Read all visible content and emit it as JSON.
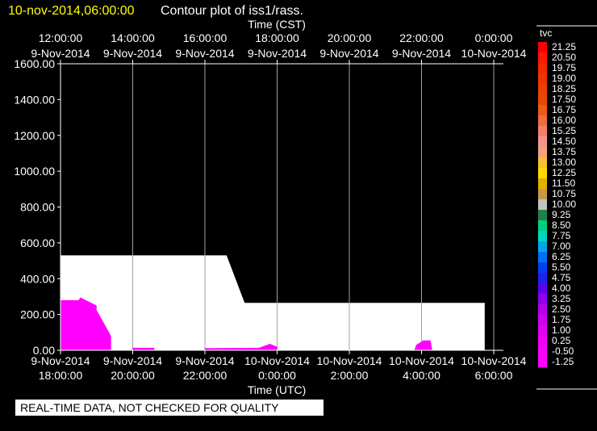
{
  "header": {
    "timestamp": "10-nov-2014,06:00:00",
    "title": "Contour plot of iss1/rass."
  },
  "notice": "REAL-TIME DATA, NOT CHECKED FOR QUALITY",
  "chart_data": {
    "type": "area",
    "title": "Contour plot of iss1/rass.",
    "x_top_label": "Time (CST)",
    "x_bottom_label": "Time (UTC)",
    "x_range_hours": [
      0,
      12
    ],
    "ylim": [
      0,
      1600
    ],
    "y_ticks": [
      "0.00",
      "200.00",
      "400.00",
      "600.00",
      "800.00",
      "1000.00",
      "1200.00",
      "1400.00",
      "1600.00"
    ],
    "top_ticks": [
      {
        "hour": 0,
        "time": "12:00:00",
        "date": "9-Nov-2014"
      },
      {
        "hour": 2,
        "time": "14:00:00",
        "date": "9-Nov-2014"
      },
      {
        "hour": 4,
        "time": "16:00:00",
        "date": "9-Nov-2014"
      },
      {
        "hour": 6,
        "time": "18:00:00",
        "date": "9-Nov-2014"
      },
      {
        "hour": 8,
        "time": "20:00:00",
        "date": "9-Nov-2014"
      },
      {
        "hour": 10,
        "time": "22:00:00",
        "date": "9-Nov-2014"
      },
      {
        "hour": 12,
        "time": "0:00:00",
        "date": "10-Nov-2014"
      }
    ],
    "bottom_ticks": [
      {
        "hour": 0,
        "date": "9-Nov-2014",
        "time": "18:00:00"
      },
      {
        "hour": 2,
        "date": "9-Nov-2014",
        "time": "20:00:00"
      },
      {
        "hour": 4,
        "date": "9-Nov-2014",
        "time": "22:00:00"
      },
      {
        "hour": 6,
        "date": "10-Nov-2014",
        "time": "0:00:00"
      },
      {
        "hour": 8,
        "date": "10-Nov-2014",
        "time": "2:00:00"
      },
      {
        "hour": 10,
        "date": "10-Nov-2014",
        "time": "4:00:00"
      },
      {
        "hour": 12,
        "date": "10-Nov-2014",
        "time": "6:00:00"
      }
    ],
    "coverage_region": {
      "color": "#ffffff",
      "points": [
        [
          0,
          0
        ],
        [
          0,
          530
        ],
        [
          4.6,
          530
        ],
        [
          5.1,
          265
        ],
        [
          11.75,
          265
        ],
        [
          11.75,
          0
        ]
      ]
    },
    "contour_regions": [
      {
        "color": "#ff00ff",
        "points": [
          [
            0,
            0
          ],
          [
            0,
            280
          ],
          [
            0.5,
            280
          ],
          [
            0.55,
            295
          ],
          [
            1.0,
            250
          ],
          [
            1.0,
            225
          ],
          [
            1.4,
            80
          ],
          [
            1.4,
            0
          ]
        ]
      },
      {
        "color": "#ff00ff",
        "points": [
          [
            2.0,
            0
          ],
          [
            2.0,
            14
          ],
          [
            2.6,
            14
          ],
          [
            2.6,
            0
          ]
        ]
      },
      {
        "color": "#ff00ff",
        "points": [
          [
            4.0,
            0
          ],
          [
            4.0,
            12
          ],
          [
            5.5,
            14
          ],
          [
            5.8,
            36
          ],
          [
            6.0,
            20
          ],
          [
            6.0,
            0
          ]
        ]
      },
      {
        "color": "#ff00ff",
        "points": [
          [
            9.8,
            0
          ],
          [
            9.85,
            30
          ],
          [
            10.05,
            55
          ],
          [
            10.25,
            55
          ],
          [
            10.3,
            0
          ]
        ]
      }
    ],
    "legend": {
      "title": "tvc",
      "entries": [
        {
          "label": "21.25",
          "color": "#ff0000"
        },
        {
          "label": "20.50",
          "color": "#fc1a00"
        },
        {
          "label": "19.75",
          "color": "#f52800"
        },
        {
          "label": "19.00",
          "color": "#ef3400"
        },
        {
          "label": "18.25",
          "color": "#ea4000"
        },
        {
          "label": "17.50",
          "color": "#e84800"
        },
        {
          "label": "16.75",
          "color": "#ed5a1a"
        },
        {
          "label": "16.00",
          "color": "#f06c3c"
        },
        {
          "label": "15.25",
          "color": "#f2806a"
        },
        {
          "label": "14.50",
          "color": "#f4948c"
        },
        {
          "label": "13.75",
          "color": "#f3a37c"
        },
        {
          "label": "13.00",
          "color": "#f6c030"
        },
        {
          "label": "12.25",
          "color": "#ffd800"
        },
        {
          "label": "11.50",
          "color": "#e0b000"
        },
        {
          "label": "10.75",
          "color": "#c89848"
        },
        {
          "label": "10.00",
          "color": "#c0c0c0"
        },
        {
          "label": "9.25",
          "color": "#20804a"
        },
        {
          "label": "8.50",
          "color": "#00d080"
        },
        {
          "label": "7.75",
          "color": "#00d8c0"
        },
        {
          "label": "7.00",
          "color": "#00a8e8"
        },
        {
          "label": "6.25",
          "color": "#0070f0"
        },
        {
          "label": "5.50",
          "color": "#0040f0"
        },
        {
          "label": "4.75",
          "color": "#2020f0"
        },
        {
          "label": "4.00",
          "color": "#6000f0"
        },
        {
          "label": "3.25",
          "color": "#9000f0"
        },
        {
          "label": "2.50",
          "color": "#b800f0"
        },
        {
          "label": "1.75",
          "color": "#d000f0"
        },
        {
          "label": "1.00",
          "color": "#e400f4"
        },
        {
          "label": "0.25",
          "color": "#f000f8"
        },
        {
          "label": "-0.50",
          "color": "#f800fc"
        },
        {
          "label": "-1.25",
          "color": "#ff00ff"
        }
      ]
    }
  }
}
